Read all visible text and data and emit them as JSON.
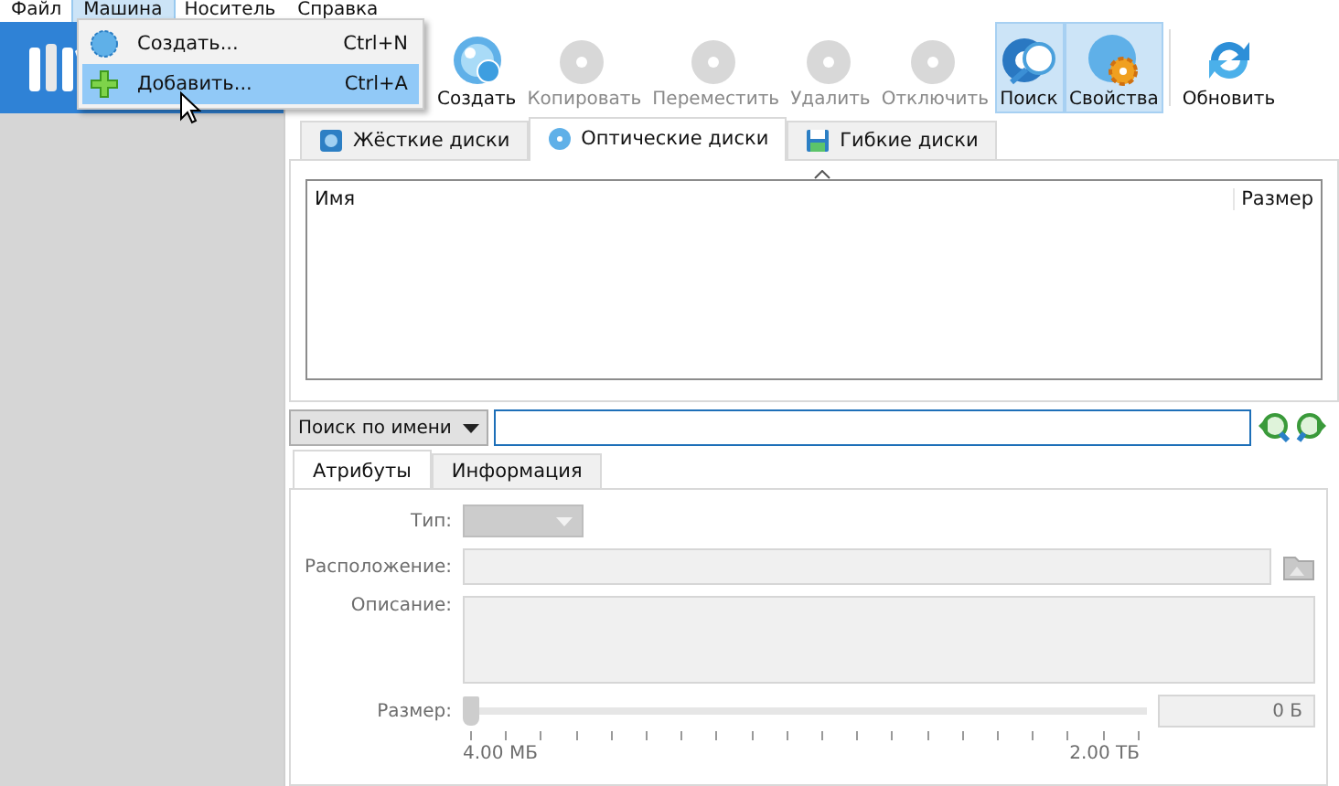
{
  "menu_bar": [
    {
      "label": "Файл",
      "selected": false
    },
    {
      "label": "Машина",
      "selected": true
    },
    {
      "label": "Носитель",
      "selected": false
    },
    {
      "label": "Справка",
      "selected": false
    }
  ],
  "dropdown_menu": [
    {
      "label": "Создать...",
      "shortcut": "Ctrl+N",
      "selected": false,
      "kind": "create"
    },
    {
      "label": "Добавить...",
      "shortcut": "Ctrl+A",
      "selected": true,
      "kind": "add"
    }
  ],
  "toolbar": [
    {
      "label": "Создать",
      "kind": "create",
      "disabled": false,
      "selected": false
    },
    {
      "label": "Копировать",
      "kind": "copy",
      "disabled": true,
      "selected": false
    },
    {
      "label": "Переместить",
      "kind": "move",
      "disabled": true,
      "selected": false
    },
    {
      "label": "Удалить",
      "kind": "remove",
      "disabled": true,
      "selected": false
    },
    {
      "label": "Отключить",
      "kind": "release",
      "disabled": true,
      "selected": false
    },
    {
      "label": "Поиск",
      "kind": "search",
      "disabled": false,
      "selected": true
    },
    {
      "label": "Свойства",
      "kind": "properties",
      "disabled": false,
      "selected": true
    },
    {
      "label": "Обновить",
      "kind": "refresh",
      "disabled": false,
      "selected": false
    }
  ],
  "media_tabs": [
    {
      "label": "Жёсткие диски",
      "kind": "hdd",
      "selected": false
    },
    {
      "label": "Оптические диски",
      "kind": "optical",
      "selected": true
    },
    {
      "label": "Гибкие диски",
      "kind": "floppy",
      "selected": false
    }
  ],
  "table": {
    "columns": [
      "Имя",
      "Размер"
    ]
  },
  "search": {
    "mode": "Поиск по имени"
  },
  "detail_tabs": [
    {
      "label": "Атрибуты",
      "selected": true
    },
    {
      "label": "Информация",
      "selected": false
    }
  ],
  "attributes": {
    "type_label": "Тип:",
    "location_label": "Расположение:",
    "description_label": "Описание:",
    "size_label": "Размер:",
    "size": {
      "level": 0,
      "reading": "0 Б",
      "min": "4.00 МБ",
      "max": "2.00 ТБ"
    }
  }
}
